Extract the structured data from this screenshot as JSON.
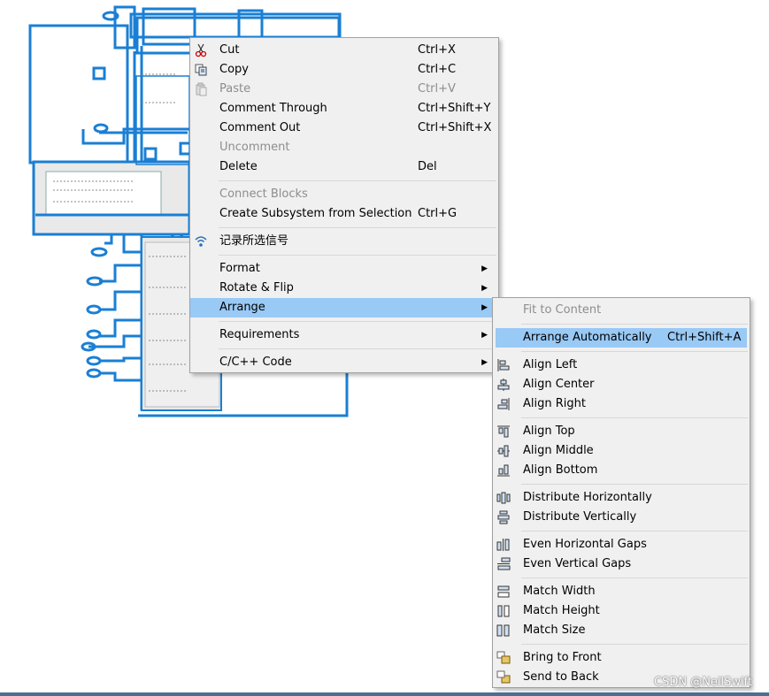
{
  "main_menu": {
    "items": [
      {
        "label": "Cut",
        "shortcut": "Ctrl+X",
        "icon": "scissors-icon"
      },
      {
        "label": "Copy",
        "shortcut": "Ctrl+C",
        "icon": "copy-icon"
      },
      {
        "label": "Paste",
        "shortcut": "Ctrl+V",
        "icon": "paste-icon",
        "disabled": true
      },
      {
        "label": "Comment Through",
        "shortcut": "Ctrl+Shift+Y"
      },
      {
        "label": "Comment Out",
        "shortcut": "Ctrl+Shift+X"
      },
      {
        "label": "Uncomment",
        "shortcut": "",
        "disabled": true
      },
      {
        "label": "Delete",
        "shortcut": "Del"
      },
      {
        "label": "Connect Blocks",
        "shortcut": "",
        "disabled": true
      },
      {
        "label": "Create Subsystem from Selection",
        "shortcut": "Ctrl+G"
      },
      {
        "label": "记录所选信号",
        "shortcut": "",
        "icon": "wireless-signal-icon"
      },
      {
        "label": "Format",
        "submenu": true
      },
      {
        "label": "Rotate & Flip",
        "submenu": true
      },
      {
        "label": "Arrange",
        "submenu": true,
        "selected": true
      },
      {
        "label": "Requirements",
        "submenu": true
      },
      {
        "label": "C/C++ Code",
        "submenu": true
      }
    ]
  },
  "arrange_menu": {
    "items": [
      {
        "label": "Fit to Content",
        "disabled": true
      },
      {
        "label": "Arrange Automatically",
        "shortcut": "Ctrl+Shift+A",
        "selected": true
      },
      {
        "label": "Align Left",
        "icon": "align-left-icon"
      },
      {
        "label": "Align Center",
        "icon": "align-center-icon"
      },
      {
        "label": "Align Right",
        "icon": "align-right-icon"
      },
      {
        "label": "Align Top",
        "icon": "align-top-icon"
      },
      {
        "label": "Align Middle",
        "icon": "align-middle-icon"
      },
      {
        "label": "Align Bottom",
        "icon": "align-bottom-icon"
      },
      {
        "label": "Distribute Horizontally",
        "icon": "distribute-horizontally-icon"
      },
      {
        "label": "Distribute Vertically",
        "icon": "distribute-vertically-icon"
      },
      {
        "label": "Even Horizontal Gaps",
        "icon": "even-horizontal-gaps-icon"
      },
      {
        "label": "Even Vertical Gaps",
        "icon": "even-vertical-gaps-icon"
      },
      {
        "label": "Match Width",
        "icon": "match-width-icon"
      },
      {
        "label": "Match Height",
        "icon": "match-height-icon"
      },
      {
        "label": "Match Size",
        "icon": "match-size-icon"
      },
      {
        "label": "Bring to Front",
        "icon": "bring-to-front-icon"
      },
      {
        "label": "Send to Back",
        "icon": "send-to-back-icon"
      }
    ]
  },
  "watermark": "CSDN @NeilSwift",
  "colors": {
    "menu_bg": "#f0f0f0",
    "highlight": "#99c9f5",
    "selection_line": "#1a7fd4",
    "disabled_text": "#8d8d8d"
  }
}
